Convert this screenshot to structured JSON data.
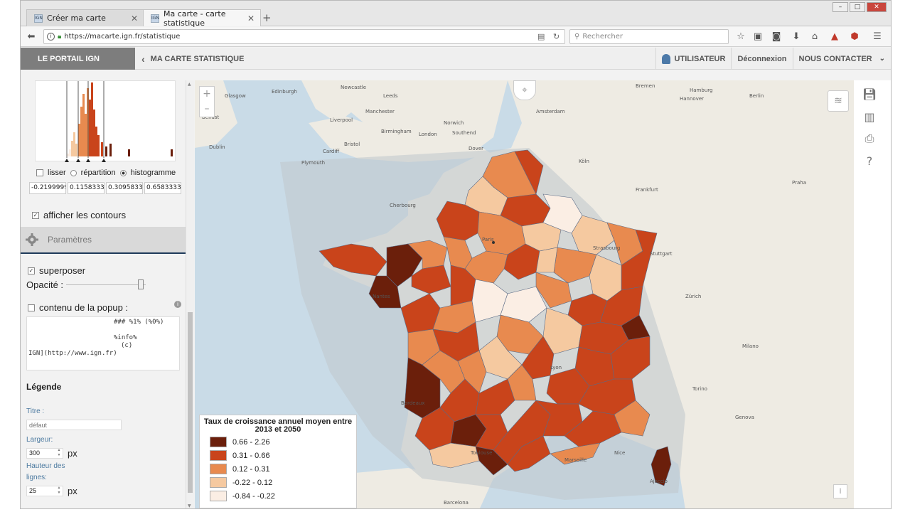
{
  "browser": {
    "tabs": [
      {
        "label": "Créer ma carte",
        "favicon": "IGN"
      },
      {
        "label": "Ma carte - carte statistique",
        "favicon": "IGN"
      }
    ],
    "url": "https://macarte.ign.fr/statistique",
    "search_placeholder": "Rechercher"
  },
  "header": {
    "portal": "LE PORTAIL IGN",
    "title": "MA CARTE STATISTIQUE",
    "user": "UTILISATEUR",
    "logout": "Déconnexion",
    "contact": "NOUS CONTACTER"
  },
  "histogram": {
    "options": {
      "smooth": "lisser",
      "distribution": "répartition",
      "histogram": "histogramme"
    },
    "selected": "histogramme",
    "bounds": [
      "-0.2199999",
      "0.11583333",
      "0.30958333",
      "0.65833333"
    ]
  },
  "panel": {
    "contours_label": "afficher les contours",
    "contours_checked": true,
    "params_title": "Paramètres",
    "superpose_label": "superposer",
    "superpose_checked": true,
    "opacity_label": "Opacité :",
    "opacity_value": 0.92,
    "popup_label": "contenu de la popup :",
    "popup_checked": false,
    "popup_lines": [
      "### %1% (%0%)",
      "%info%",
      "(c)",
      "IGN](http://www.ign.fr)"
    ],
    "legend_title": "Légende",
    "titre_label": "Titre :",
    "titre_placeholder": "défaut",
    "largeur_label": "Largeur:",
    "largeur_value": "300",
    "largeur_unit": "px",
    "hauteur_label_1": "Hauteur des",
    "hauteur_label_2": "lignes:",
    "hauteur_value": "25",
    "hauteur_unit": "px"
  },
  "map": {
    "legend": {
      "title": "Taux de croissance annuel moyen entre 2013 et 2050",
      "classes": [
        {
          "label": "0.66 - 2.26",
          "color": "#6b1f0b"
        },
        {
          "label": "0.31 - 0.66",
          "color": "#c9441b"
        },
        {
          "label": "0.12 - 0.31",
          "color": "#e88a4f"
        },
        {
          "label": "-0.22 - 0.12",
          "color": "#f5c9a0"
        },
        {
          "label": "-0.84 - -0.22",
          "color": "#fbeee4"
        }
      ]
    },
    "labels": [
      "Glasgow",
      "Edinburgh",
      "Newcastle",
      "Belfast",
      "Dublin",
      "Liverpool",
      "Manchester",
      "Leeds",
      "Birmingham",
      "Norwich",
      "Cardiff",
      "Bristol",
      "London",
      "Southend",
      "Plymouth",
      "Dover",
      "Cherbourg",
      "Amsterdam",
      "Hamburg",
      "Berlin",
      "Hannover",
      "Bremen",
      "Köln",
      "Frankfurt",
      "Stuttgart",
      "Praha",
      "Strasbourg",
      "Zürich",
      "Milano",
      "Torino",
      "Genova",
      "Barcelona",
      "Toulouse",
      "Bordeaux",
      "Nantes",
      "Lyon",
      "Paris",
      "Marseille",
      "Nice",
      "Ajaccio"
    ]
  },
  "toolbar_icons": [
    "save-icon",
    "map-icon",
    "print-icon",
    "help-icon"
  ]
}
